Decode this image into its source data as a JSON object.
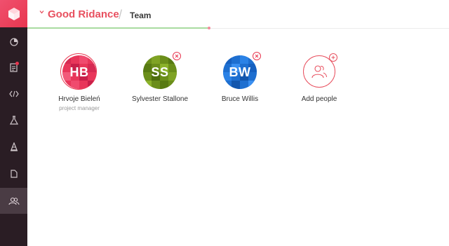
{
  "colors": {
    "accent": "#e8505f",
    "sidebar_bg": "#2a1d24",
    "sidebar_active": "#4a3c44",
    "progress": "#a9dba0"
  },
  "header": {
    "project_title": "Good Ridance",
    "breadcrumb_separator": "/",
    "current_page": "Team"
  },
  "sidebar": {
    "items": [
      {
        "icon": "pie-chart-icon"
      },
      {
        "icon": "document-list-icon",
        "has_notification": true
      },
      {
        "icon": "code-icon"
      },
      {
        "icon": "flask-icon"
      },
      {
        "icon": "traffic-cone-icon"
      },
      {
        "icon": "document-icon"
      },
      {
        "icon": "team-icon",
        "active": true
      }
    ]
  },
  "members": [
    {
      "initials": "HB",
      "name": "Hrvoje Bieleń",
      "role": "project manager",
      "color": "#e8365a",
      "removable": false
    },
    {
      "initials": "SS",
      "name": "Sylvester Stallone",
      "role": "",
      "color": "#6b8e1a",
      "removable": true
    },
    {
      "initials": "BW",
      "name": "Bruce Willis",
      "role": "",
      "color": "#1e6fd0",
      "removable": true
    }
  ],
  "add_people": {
    "label": "Add people"
  }
}
